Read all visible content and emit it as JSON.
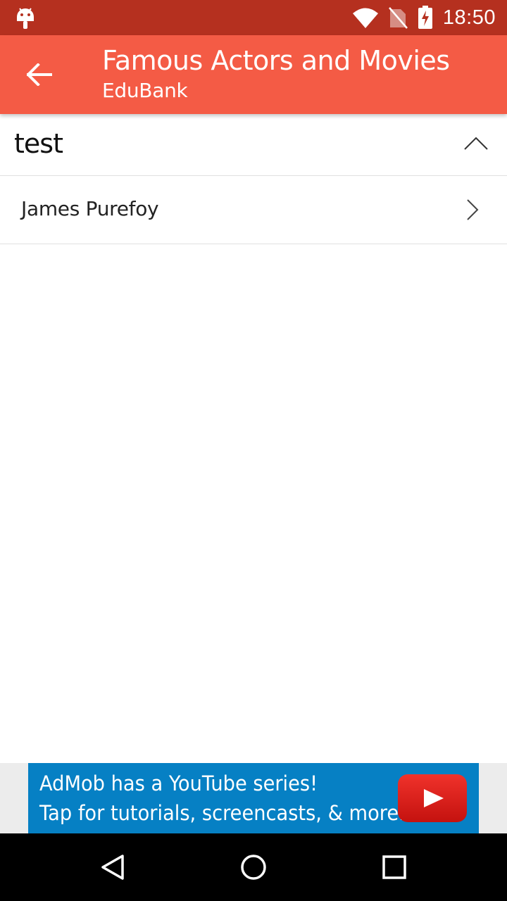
{
  "status_bar": {
    "time": "18:50",
    "icons": [
      "android-debug-icon",
      "wifi-icon",
      "no-sim-icon",
      "battery-charging-icon"
    ]
  },
  "app_bar": {
    "title": "Famous Actors and Movies",
    "subtitle": "EduBank",
    "back_icon": "arrow-back-icon",
    "background": "#f45b45"
  },
  "section": {
    "title": "test",
    "expanded": true,
    "toggle_icon": "chevron-up-icon",
    "items": [
      {
        "label": "James Purefoy",
        "icon": "chevron-right-icon"
      }
    ]
  },
  "ad": {
    "line1": "AdMob has a YouTube series!",
    "line2": "Tap for tutorials, screencasts, & more.",
    "logo_icon": "youtube-play-icon",
    "background": "#0680c4"
  },
  "nav_bar": {
    "icons": [
      "nav-back-icon",
      "nav-home-icon",
      "nav-recents-icon"
    ]
  },
  "colors": {
    "status_bar": "#b5301f",
    "app_bar": "#f45b45",
    "divider": "#e0e0e0",
    "ad_blue": "#0680c4",
    "youtube_red": "#e0201b"
  }
}
